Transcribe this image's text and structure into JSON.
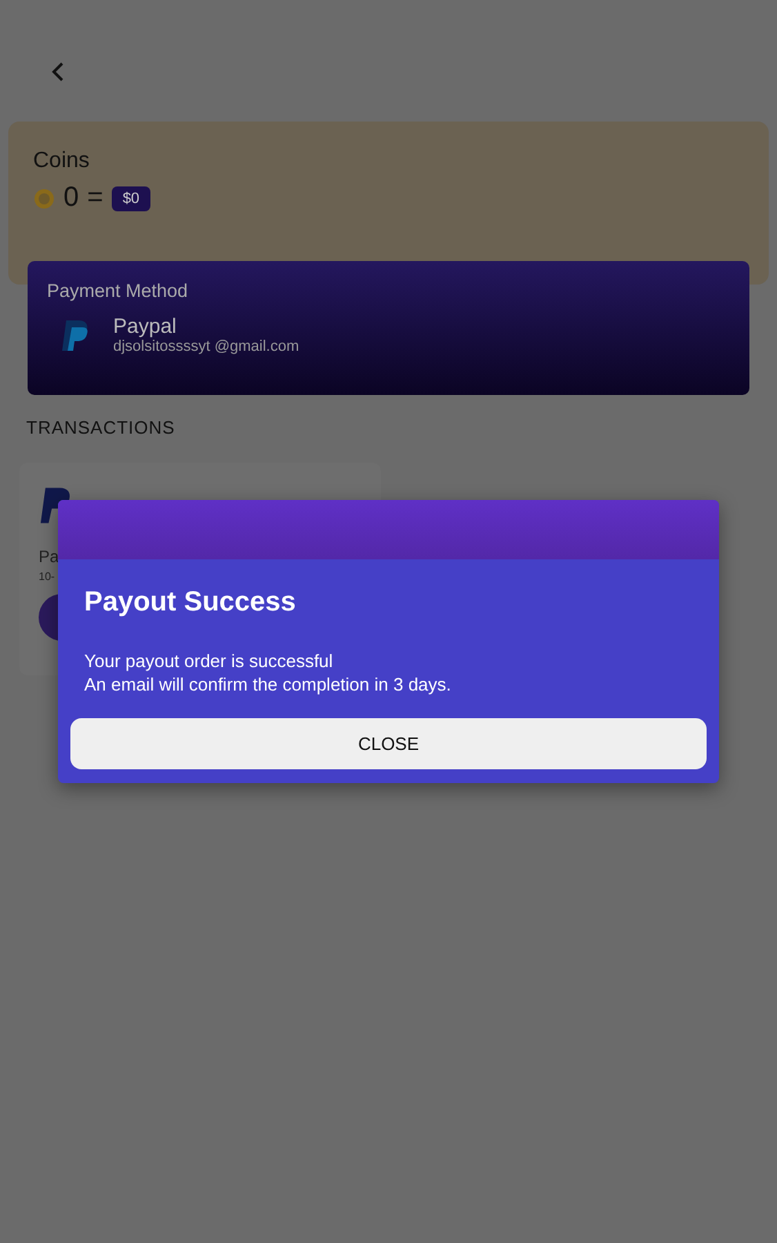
{
  "header": {
    "back": true
  },
  "coins": {
    "title": "Coins",
    "amount": "0",
    "equals": "=",
    "value": "$0"
  },
  "payment_method": {
    "title": "Payment Method",
    "name": "Paypal",
    "email": "djsolsitossssyt @gmail.com"
  },
  "transactions": {
    "title": "TRANSACTIONS",
    "items": [
      {
        "name": "Pa",
        "date": "10-"
      }
    ]
  },
  "dialog": {
    "title": "Payout Success",
    "message": [
      "Your payout order is successful",
      "An email will confirm the completion in 3 days."
    ],
    "button": "CLOSE"
  }
}
